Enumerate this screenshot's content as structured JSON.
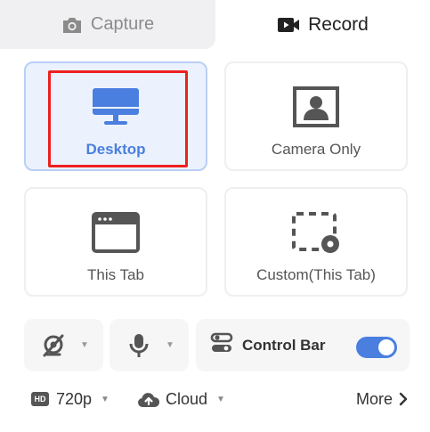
{
  "tabs": {
    "capture_label": "Capture",
    "record_label": "Record",
    "active": "record"
  },
  "modes": [
    {
      "id": "desktop",
      "label": "Desktop",
      "icon": "monitor-icon",
      "selected": true
    },
    {
      "id": "camera",
      "label": "Camera Only",
      "icon": "person-portrait-icon",
      "selected": false
    },
    {
      "id": "tab",
      "label": "This Tab",
      "icon": "browser-window-icon",
      "selected": false
    },
    {
      "id": "custom",
      "label": "Custom(This Tab)",
      "icon": "dashed-region-icon",
      "selected": false
    }
  ],
  "controls": {
    "camera_icon": "camera-off-icon",
    "mic_icon": "microphone-icon",
    "control_bar_label": "Control Bar",
    "control_bar_enabled": true
  },
  "footer": {
    "resolution_badge": "HD",
    "resolution": "720p",
    "storage": "Cloud",
    "more": "More"
  },
  "colors": {
    "accent": "#4a7fe0",
    "selected_bg": "#ecf2fd",
    "highlight_box": "#ee1f1f",
    "icon_gray": "#555555"
  }
}
